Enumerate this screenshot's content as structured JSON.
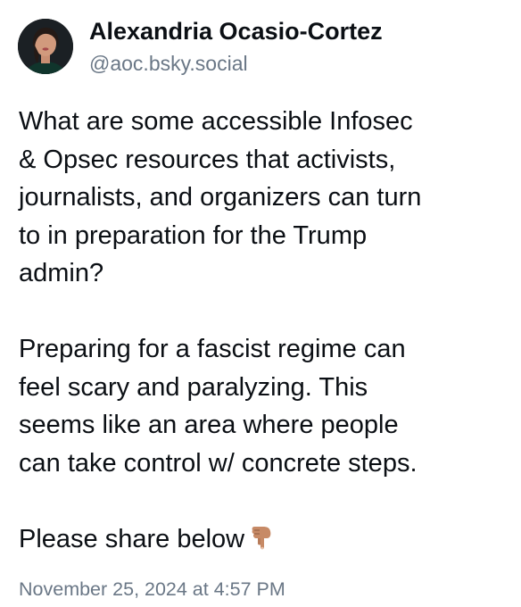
{
  "author": {
    "display_name": "Alexandria Ocasio-Cortez",
    "handle": "@aoc.bsky.social",
    "avatar_icon": "profile-photo"
  },
  "post": {
    "paragraphs": [
      "What are some accessible Infosec\n& Opsec resources that activists,\njournalists, and organizers can turn\nto in preparation for the Trump\nadmin?",
      "Preparing for a fascist regime can\nfeel scary and paralyzing. This\nseems like an area where people\ncan take control w/ concrete steps.",
      "Please share below"
    ],
    "trailing_emoji": "backhand-index-pointing-down-icon",
    "timestamp": "November 25, 2024 at 4:57 PM"
  },
  "colors": {
    "text": "#0b0f14",
    "secondary_text": "#6a7786",
    "background": "#ffffff"
  }
}
